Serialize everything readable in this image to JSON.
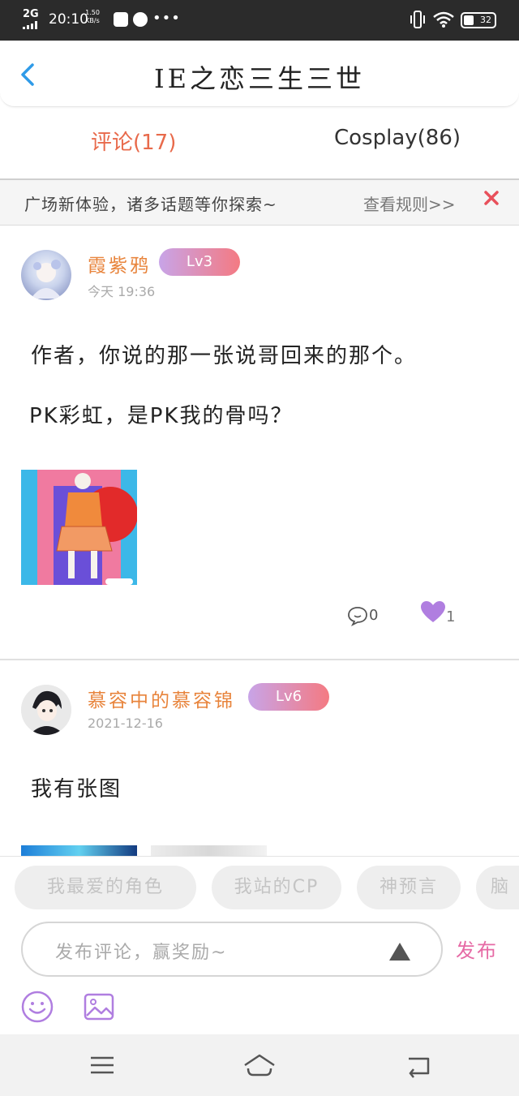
{
  "status_bar": {
    "network": "2G",
    "time": "20:10",
    "speed_value": "1.50",
    "speed_unit": "KB/s",
    "battery": "32"
  },
  "header": {
    "title": "IE之恋三生三世"
  },
  "tabs": [
    {
      "label": "评论(17)",
      "active": true
    },
    {
      "label": "Cosplay(86)",
      "active": false
    }
  ],
  "notice": {
    "text": "广场新体验，诸多话题等你探索~",
    "link": "查看规则>>"
  },
  "posts": [
    {
      "username": "霞紫鸦",
      "level": "Lv3",
      "time": "今天 19:36",
      "content_lines": [
        "作者，你说的那一张说哥回来的那个。",
        "PK彩虹，是PK我的骨吗？"
      ],
      "comment_count": "0",
      "like_count": "1"
    },
    {
      "username": "慕容中的慕容锦",
      "level": "Lv6",
      "time": "2021-12-16",
      "content_lines": [
        "我有张图"
      ]
    }
  ],
  "compose": {
    "chips": [
      "我最爱的角色",
      "我站的CP",
      "神预言",
      "脑"
    ],
    "placeholder": "发布评论，赢奖励~",
    "send_label": "发布"
  },
  "colors": {
    "accent_orange": "#e86a4b",
    "username_orange": "#e8843c",
    "badge_gradient_start": "#c8a4e8",
    "badge_gradient_end": "#f47a82",
    "send_pink": "#e66aa5",
    "like_purple": "#b07ee0",
    "back_blue": "#2f9be8",
    "close_red": "#e8505b"
  },
  "icons": [
    "back-icon",
    "close-icon",
    "comment-icon",
    "heart-icon",
    "emoji-icon",
    "image-icon",
    "triangle-icon",
    "menu-icon",
    "home-icon",
    "return-icon"
  ]
}
